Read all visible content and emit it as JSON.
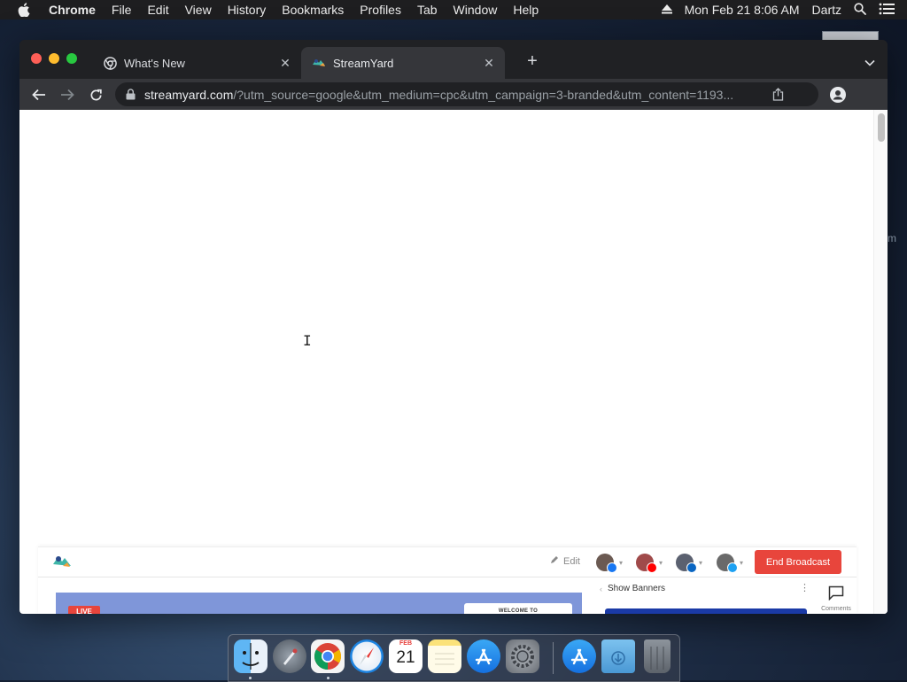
{
  "menubar": {
    "app_name": "Chrome",
    "items": [
      "File",
      "Edit",
      "View",
      "History",
      "Bookmarks",
      "Profiles",
      "Tab",
      "Window",
      "Help"
    ],
    "clock": "Mon Feb 21  8:06 AM",
    "user": "Dartz"
  },
  "tabs": [
    {
      "title": "What's New",
      "favicon": "chrome-icon",
      "active": false
    },
    {
      "title": "StreamYard",
      "favicon": "streamyard-icon",
      "active": true
    }
  ],
  "address_bar": {
    "host": "streamyard.com",
    "path": "/?utm_source=google&utm_medium=cpc&utm_campaign=3-branded&utm_content=1193..."
  },
  "page": {
    "studio_preview": {
      "edit_label": "Edit",
      "end_broadcast_label": "End Broadcast",
      "live_label": "LIVE",
      "welcome_label": "WELCOME TO",
      "show_banners_label": "Show Banners",
      "comments_label": "Comments",
      "destinations": [
        {
          "network": "facebook",
          "badge_color": "#1877f2"
        },
        {
          "network": "youtube",
          "badge_color": "#ff0000"
        },
        {
          "network": "linkedin",
          "badge_color": "#0a66c2"
        },
        {
          "network": "twitter",
          "badge_color": "#1da1f2"
        }
      ]
    }
  },
  "dock": {
    "apps": [
      "Finder",
      "Launchpad",
      "Google Chrome",
      "Safari",
      "Calendar",
      "Notes",
      "App Store",
      "System Preferences",
      "App Store",
      "Downloads",
      "Trash"
    ],
    "calendar_month": "FEB",
    "calendar_day": "21"
  },
  "colors": {
    "accent_red": "#e8453c",
    "chrome_dark": "#202124",
    "chrome_toolbar": "#35363a"
  }
}
